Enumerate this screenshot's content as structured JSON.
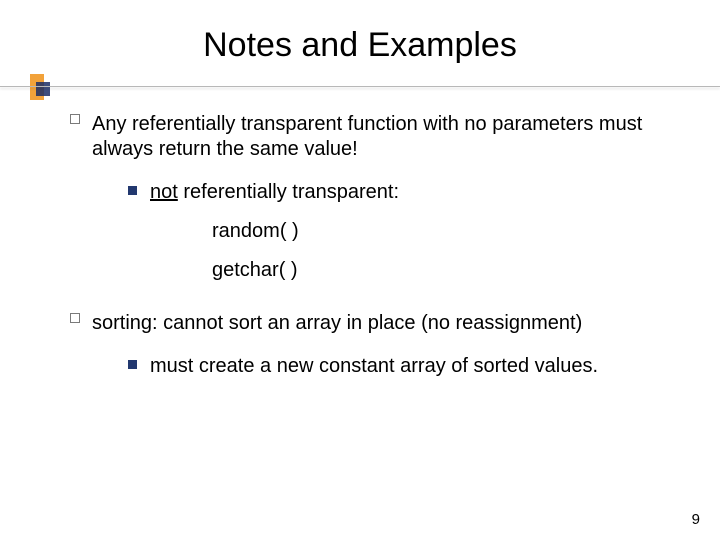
{
  "title": "Notes and Examples",
  "item1": {
    "text": "Any referentially transparent function with no parameters must always return the same value!",
    "sub": {
      "underlined": "not",
      "rest": " referentially transparent:",
      "ex1": "random( )",
      "ex2": "getchar( )"
    }
  },
  "item2": {
    "text": "sorting: cannot sort an array in place (no reassignment)",
    "sub": {
      "text": "must create a new constant array of sorted values."
    }
  },
  "pagenum": "9"
}
